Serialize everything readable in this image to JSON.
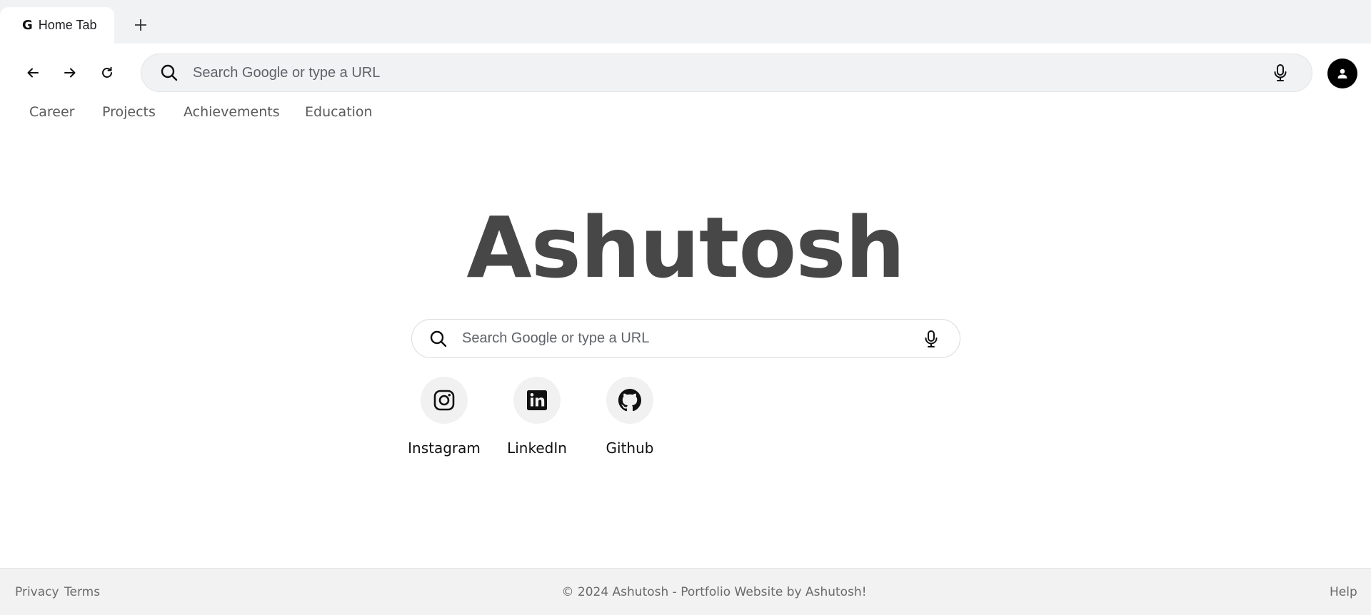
{
  "tab": {
    "icon": "google-g-icon",
    "icon_glyph": "G",
    "label": "Home Tab"
  },
  "new_tab": {
    "icon": "plus-icon"
  },
  "toolbar": {
    "back_icon": "arrow-left-icon",
    "forward_icon": "arrow-right-icon",
    "reload_icon": "reload-icon",
    "omnibox_placeholder": "Search Google or type a URL",
    "mic_icon": "microphone-icon",
    "avatar_icon": "user-avatar-icon"
  },
  "nav_links": [
    "Career",
    "Projects",
    "Achievements",
    "Education"
  ],
  "hero": {
    "title": "Ashutosh"
  },
  "main_search": {
    "placeholder": "Search Google or type a URL"
  },
  "shortcuts": [
    {
      "label": "Instagram",
      "icon": "instagram-icon"
    },
    {
      "label": "LinkedIn",
      "icon": "linkedin-icon"
    },
    {
      "label": "Github",
      "icon": "github-icon"
    }
  ],
  "footer": {
    "privacy": "Privacy",
    "terms": "Terms",
    "copyright": "© 2024 Ashutosh - Portfolio Website by Ashutosh!",
    "help": "Help"
  },
  "colors": {
    "tabstrip_bg": "#f1f2f4",
    "title_color": "#474747",
    "footer_bg": "#f2f2f2",
    "avatar_bg": "#000000"
  }
}
